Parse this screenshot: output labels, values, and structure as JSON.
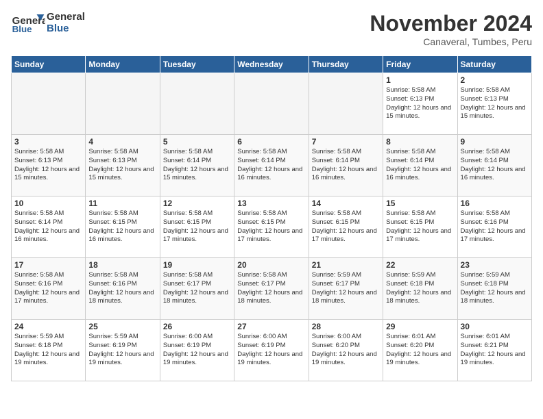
{
  "logo": {
    "general": "General",
    "blue": "Blue"
  },
  "header": {
    "title": "November 2024",
    "location": "Canaveral, Tumbes, Peru"
  },
  "weekdays": [
    "Sunday",
    "Monday",
    "Tuesday",
    "Wednesday",
    "Thursday",
    "Friday",
    "Saturday"
  ],
  "weeks": [
    [
      {
        "day": "",
        "info": ""
      },
      {
        "day": "",
        "info": ""
      },
      {
        "day": "",
        "info": ""
      },
      {
        "day": "",
        "info": ""
      },
      {
        "day": "",
        "info": ""
      },
      {
        "day": "1",
        "info": "Sunrise: 5:58 AM\nSunset: 6:13 PM\nDaylight: 12 hours and 15 minutes."
      },
      {
        "day": "2",
        "info": "Sunrise: 5:58 AM\nSunset: 6:13 PM\nDaylight: 12 hours and 15 minutes."
      }
    ],
    [
      {
        "day": "3",
        "info": "Sunrise: 5:58 AM\nSunset: 6:13 PM\nDaylight: 12 hours and 15 minutes."
      },
      {
        "day": "4",
        "info": "Sunrise: 5:58 AM\nSunset: 6:13 PM\nDaylight: 12 hours and 15 minutes."
      },
      {
        "day": "5",
        "info": "Sunrise: 5:58 AM\nSunset: 6:14 PM\nDaylight: 12 hours and 15 minutes."
      },
      {
        "day": "6",
        "info": "Sunrise: 5:58 AM\nSunset: 6:14 PM\nDaylight: 12 hours and 16 minutes."
      },
      {
        "day": "7",
        "info": "Sunrise: 5:58 AM\nSunset: 6:14 PM\nDaylight: 12 hours and 16 minutes."
      },
      {
        "day": "8",
        "info": "Sunrise: 5:58 AM\nSunset: 6:14 PM\nDaylight: 12 hours and 16 minutes."
      },
      {
        "day": "9",
        "info": "Sunrise: 5:58 AM\nSunset: 6:14 PM\nDaylight: 12 hours and 16 minutes."
      }
    ],
    [
      {
        "day": "10",
        "info": "Sunrise: 5:58 AM\nSunset: 6:14 PM\nDaylight: 12 hours and 16 minutes."
      },
      {
        "day": "11",
        "info": "Sunrise: 5:58 AM\nSunset: 6:15 PM\nDaylight: 12 hours and 16 minutes."
      },
      {
        "day": "12",
        "info": "Sunrise: 5:58 AM\nSunset: 6:15 PM\nDaylight: 12 hours and 17 minutes."
      },
      {
        "day": "13",
        "info": "Sunrise: 5:58 AM\nSunset: 6:15 PM\nDaylight: 12 hours and 17 minutes."
      },
      {
        "day": "14",
        "info": "Sunrise: 5:58 AM\nSunset: 6:15 PM\nDaylight: 12 hours and 17 minutes."
      },
      {
        "day": "15",
        "info": "Sunrise: 5:58 AM\nSunset: 6:15 PM\nDaylight: 12 hours and 17 minutes."
      },
      {
        "day": "16",
        "info": "Sunrise: 5:58 AM\nSunset: 6:16 PM\nDaylight: 12 hours and 17 minutes."
      }
    ],
    [
      {
        "day": "17",
        "info": "Sunrise: 5:58 AM\nSunset: 6:16 PM\nDaylight: 12 hours and 17 minutes."
      },
      {
        "day": "18",
        "info": "Sunrise: 5:58 AM\nSunset: 6:16 PM\nDaylight: 12 hours and 18 minutes."
      },
      {
        "day": "19",
        "info": "Sunrise: 5:58 AM\nSunset: 6:17 PM\nDaylight: 12 hours and 18 minutes."
      },
      {
        "day": "20",
        "info": "Sunrise: 5:58 AM\nSunset: 6:17 PM\nDaylight: 12 hours and 18 minutes."
      },
      {
        "day": "21",
        "info": "Sunrise: 5:59 AM\nSunset: 6:17 PM\nDaylight: 12 hours and 18 minutes."
      },
      {
        "day": "22",
        "info": "Sunrise: 5:59 AM\nSunset: 6:18 PM\nDaylight: 12 hours and 18 minutes."
      },
      {
        "day": "23",
        "info": "Sunrise: 5:59 AM\nSunset: 6:18 PM\nDaylight: 12 hours and 18 minutes."
      }
    ],
    [
      {
        "day": "24",
        "info": "Sunrise: 5:59 AM\nSunset: 6:18 PM\nDaylight: 12 hours and 19 minutes."
      },
      {
        "day": "25",
        "info": "Sunrise: 5:59 AM\nSunset: 6:19 PM\nDaylight: 12 hours and 19 minutes."
      },
      {
        "day": "26",
        "info": "Sunrise: 6:00 AM\nSunset: 6:19 PM\nDaylight: 12 hours and 19 minutes."
      },
      {
        "day": "27",
        "info": "Sunrise: 6:00 AM\nSunset: 6:19 PM\nDaylight: 12 hours and 19 minutes."
      },
      {
        "day": "28",
        "info": "Sunrise: 6:00 AM\nSunset: 6:20 PM\nDaylight: 12 hours and 19 minutes."
      },
      {
        "day": "29",
        "info": "Sunrise: 6:01 AM\nSunset: 6:20 PM\nDaylight: 12 hours and 19 minutes."
      },
      {
        "day": "30",
        "info": "Sunrise: 6:01 AM\nSunset: 6:21 PM\nDaylight: 12 hours and 19 minutes."
      }
    ]
  ]
}
